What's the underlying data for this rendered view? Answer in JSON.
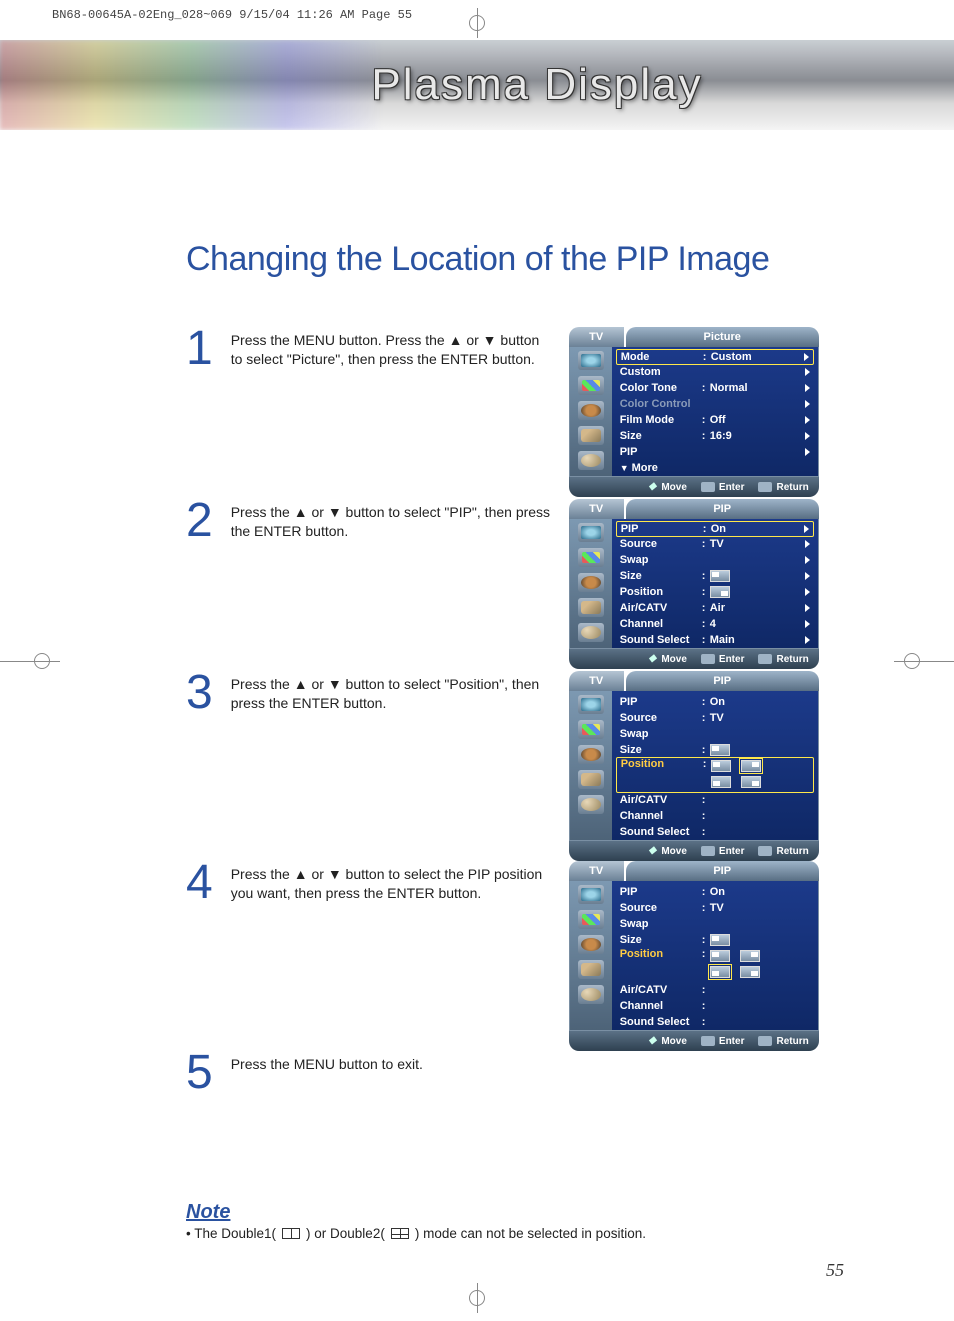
{
  "print_meta": "BN68-00645A-02Eng_028~069  9/15/04  11:26 AM  Page 55",
  "banner_title": "Plasma Display",
  "page_title": "Changing the Location of the PIP Image",
  "steps": {
    "s1": {
      "num": "1",
      "text": "Press the MENU button. Press the ▲ or ▼ button to select \"Picture\", then press the ENTER button."
    },
    "s2": {
      "num": "2",
      "text": "Press the ▲ or ▼ button to select \"PIP\", then press the ENTER button."
    },
    "s3": {
      "num": "3",
      "text": "Press the ▲ or ▼ button to select \"Position\", then press the ENTER button."
    },
    "s4": {
      "num": "4",
      "text": "Press the ▲ or ▼ button to select the PIP position you want, then press the ENTER button."
    },
    "s5": {
      "num": "5",
      "text": "Press the MENU button to exit."
    }
  },
  "osd": {
    "head_tv": "TV",
    "head_picture": "Picture",
    "head_pip": "PIP",
    "foot": {
      "move": "Move",
      "enter": "Enter",
      "return": "Return"
    },
    "picture_rows": {
      "mode": {
        "label": "Mode",
        "value": "Custom"
      },
      "custom": {
        "label": "Custom",
        "value": ""
      },
      "colortone": {
        "label": "Color Tone",
        "value": "Normal"
      },
      "colorctrl": {
        "label": "Color Control",
        "value": ""
      },
      "filmmode": {
        "label": "Film Mode",
        "value": "Off"
      },
      "size": {
        "label": "Size",
        "value": "16:9"
      },
      "pip": {
        "label": "PIP",
        "value": ""
      },
      "more": {
        "label": "More"
      }
    },
    "pip_rows": {
      "pip": {
        "label": "PIP",
        "value": "On"
      },
      "source": {
        "label": "Source",
        "value": "TV"
      },
      "swap": {
        "label": "Swap",
        "value": ""
      },
      "size": {
        "label": "Size",
        "value": ""
      },
      "position": {
        "label": "Position",
        "value": ""
      },
      "aircatv": {
        "label": "Air/CATV",
        "value": "Air"
      },
      "channel": {
        "label": "Channel",
        "value": "4"
      },
      "ssel": {
        "label": "Sound Select",
        "value": "Main"
      }
    }
  },
  "note": {
    "heading": "Note",
    "prefix": "•  The Double1(",
    "mid": ") or Double2(",
    "suffix": ") mode can not be selected in position."
  },
  "page_number": "55"
}
